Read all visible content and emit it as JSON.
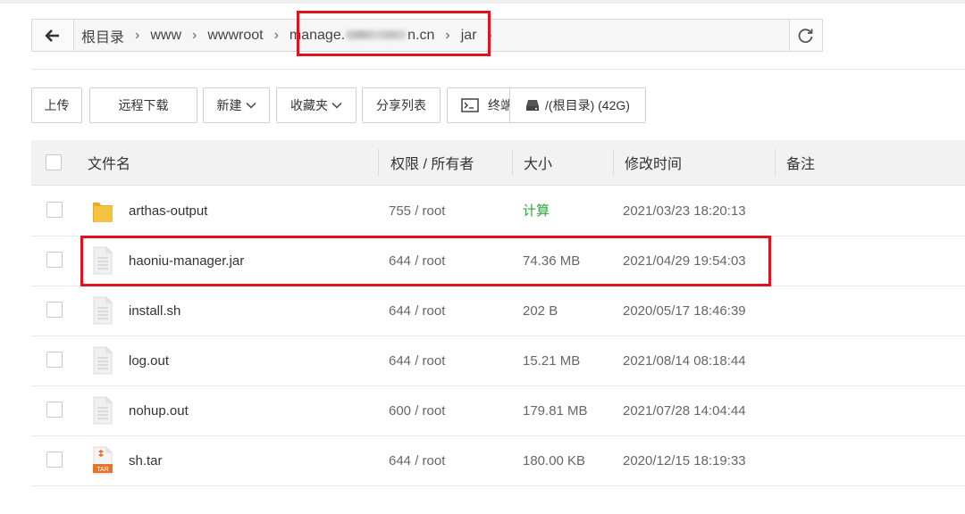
{
  "breadcrumb": {
    "items": [
      "根目录",
      "www",
      "wwwroot",
      "manage.",
      "n.cn",
      "jar"
    ],
    "separator": "›"
  },
  "toolbar": {
    "upload": "上传",
    "remote_download": "远程下载",
    "new": "新建",
    "favorites": "收藏夹",
    "share_list": "分享列表",
    "terminal": "终端",
    "disk": "/(根目录) (42G)"
  },
  "table": {
    "headers": [
      "文件名",
      "权限 / 所有者",
      "大小",
      "修改时间",
      "备注"
    ],
    "rows": [
      {
        "name": "arthas-output",
        "perm": "755 / root",
        "size": "计算",
        "mtime": "2021/03/23 18:20:13",
        "icon": "folder-icon"
      },
      {
        "name": "haoniu-manager.jar",
        "perm": "644 / root",
        "size": "74.36 MB",
        "mtime": "2021/04/29 19:54:03",
        "icon": "file-icon"
      },
      {
        "name": "install.sh",
        "perm": "644 / root",
        "size": "202 B",
        "mtime": "2020/05/17 18:46:39",
        "icon": "file-icon"
      },
      {
        "name": "log.out",
        "perm": "644 / root",
        "size": "15.21 MB",
        "mtime": "2021/08/14 08:18:44",
        "icon": "file-icon"
      },
      {
        "name": "nohup.out",
        "perm": "600 / root",
        "size": "179.81 MB",
        "mtime": "2021/07/28 14:04:44",
        "icon": "file-icon"
      },
      {
        "name": "sh.tar",
        "perm": "644 / root",
        "size": "180.00 KB",
        "mtime": "2020/12/15 18:19:33",
        "icon": "tar-archive-icon",
        "icon_label": "TAR"
      }
    ]
  },
  "colors": {
    "highlight": "#e0121c",
    "calc_link": "#29a83a",
    "folder": "#f5c342"
  }
}
